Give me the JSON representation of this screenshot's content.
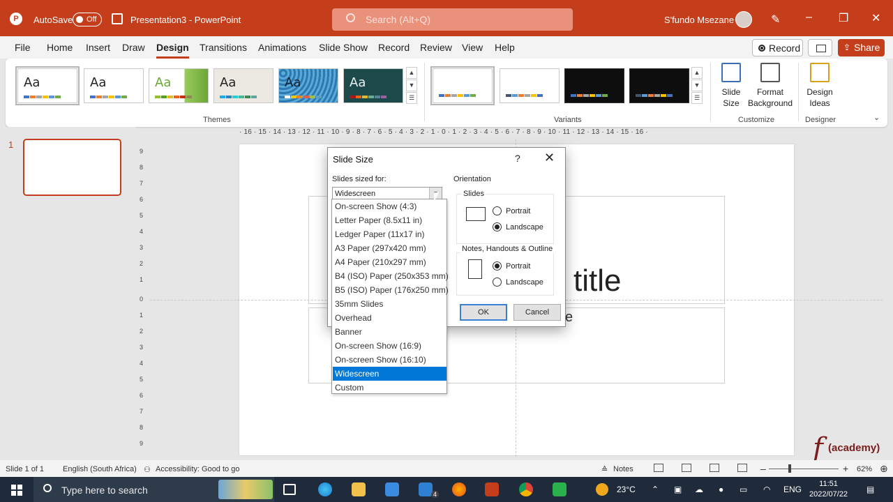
{
  "titlebar": {
    "autosave_label": "AutoSave",
    "autosave_state": "Off",
    "document_title": "Presentation3  -  PowerPoint",
    "search_placeholder": "Search (Alt+Q)",
    "user_name": "S'fundo Msezane"
  },
  "menu": {
    "tabs": [
      "File",
      "Home",
      "Insert",
      "Draw",
      "Design",
      "Transitions",
      "Animations",
      "Slide Show",
      "Record",
      "Review",
      "View",
      "Help"
    ],
    "active_tab": "Design",
    "record_label": "Record",
    "share_label": "Share"
  },
  "ribbon": {
    "theme_text": "Aa",
    "themes_label": "Themes",
    "variants_label": "Variants",
    "customize_label": "Customize",
    "designer_label": "Designer",
    "slide_size_label": "Slide Size",
    "format_background_label": "Format Background",
    "design_ideas_label": "Design Ideas",
    "accent_color": "#c43e1c"
  },
  "slides_pane": {
    "slide_number": "1"
  },
  "ruler": {
    "horizontal": "· 16 · 15 · 14 · 13 · 12 · 11 · 10 · 9 · 8 · 7 · 6 · 5 · 4 · 3 · 2 · 1 · 0 · 1 · 2 · 3 · 4 · 5 · 6 · 7 · 8 · 9 · 10 · 11 · 12 · 13 · 14 · 15 · 16 ·",
    "vertical": [
      "9",
      "8",
      "7",
      "6",
      "5",
      "4",
      "3",
      "2",
      "1",
      "0",
      "1",
      "2",
      "3",
      "4",
      "5",
      "6",
      "7",
      "8",
      "9"
    ]
  },
  "slide": {
    "title_fragment": "title",
    "subtitle_fragment": "e"
  },
  "dialog": {
    "title": "Slide Size",
    "help": "?",
    "close": "✕",
    "sized_for_label": "Slides sized for:",
    "sized_for_value": "Widescreen",
    "orientation_label": "Orientation",
    "slides_group_label": "Slides",
    "notes_group_label": "Notes, Handouts & Outline",
    "portrait_label": "Portrait",
    "landscape_label": "Landscape",
    "slides_orientation": "Landscape",
    "notes_orientation": "Portrait",
    "ok_label": "OK",
    "cancel_label": "Cancel"
  },
  "dropdown": {
    "options": [
      "On-screen Show (4:3)",
      "Letter Paper (8.5x11 in)",
      "Ledger Paper (11x17 in)",
      "A3 Paper (297x420 mm)",
      "A4 Paper (210x297 mm)",
      "B4 (ISO) Paper (250x353 mm)",
      "B5 (ISO) Paper (176x250 mm)",
      "35mm Slides",
      "Overhead",
      "Banner",
      "On-screen Show (16:9)",
      "On-screen Show (16:10)",
      "Widescreen",
      "Custom"
    ],
    "selected": "Widescreen",
    "highlight_color": "#0078d7"
  },
  "watermark": {
    "letter": "f",
    "text": "(academy)"
  },
  "statusbar": {
    "slide_info": "Slide 1 of 1",
    "language": "English (South Africa)",
    "accessibility": "Accessibility: Good to go",
    "notes_label": "Notes",
    "zoom": "62%"
  },
  "taskbar": {
    "search_placeholder": "Type here to search",
    "weather": "23°C",
    "language": "ENG",
    "time": "11:51",
    "date": "2022/07/22",
    "mail_badge": "4"
  }
}
